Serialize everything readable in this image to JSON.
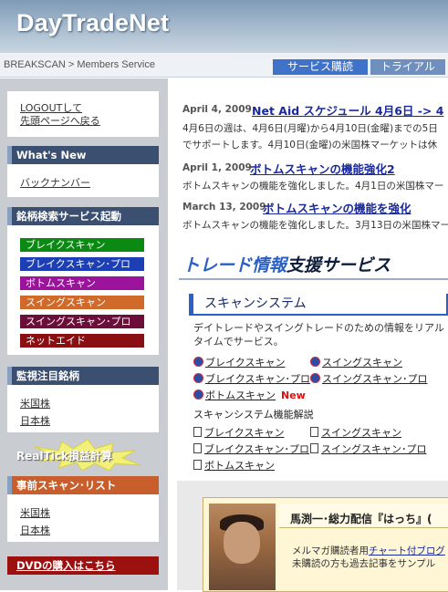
{
  "header": {
    "logo": "DayTradeNet",
    "breadcrumb": "BREAKSCAN > Members Service",
    "tabs": [
      "サービス購読",
      "トライアル"
    ]
  },
  "sidebar": {
    "logout": [
      "LOGOUTして",
      "先頭ページへ戻る"
    ],
    "whats_new": "What's New",
    "backnumber": "バックナンバー",
    "scan_launch": "銘柄検索サービス起動",
    "scan_buttons": [
      {
        "label": "ブレイクスキャン",
        "color": "#0a8a12"
      },
      {
        "label": "ブレイクスキャン･プロ",
        "color": "#1d3fb5"
      },
      {
        "label": "ボトムスキャン",
        "color": "#9b129b"
      },
      {
        "label": "スイングスキャン",
        "color": "#d06a2a"
      },
      {
        "label": "スイングスキャン･プロ",
        "color": "#6b0f3a"
      },
      {
        "label": "ネットエイド",
        "color": "#8a0f12"
      }
    ],
    "watch": "監視注目銘柄",
    "watch_links": [
      "米国株",
      "日本株"
    ],
    "badge": "RealTick損益計算",
    "prescan": "事前スキャン･リスト",
    "prescan_links": [
      "米国株",
      "日本株"
    ],
    "dvd": "DVDの購入はこちら"
  },
  "news": [
    {
      "date": "April 4, 2009",
      "title": "Net Aid スケジュール 4月6日 -> 4",
      "body": [
        "4月6日の週は、4月6日(月曜)から4月10日(金曜)までの5日",
        "でサポートします。4月10日(金曜)の米国株マーケットは休"
      ]
    },
    {
      "date": "April 1, 2009",
      "title": "ボトムスキャンの機能強化2",
      "body": [
        "ボトムスキャンの機能を強化しました。4月1日の米国株マー"
      ]
    },
    {
      "date": "March 13, 2009",
      "title": "ボトムスキャンの機能を強化",
      "body": [
        "ボトムスキャンの機能を強化しました。3月13日の米国株マー"
      ]
    }
  ],
  "trade_heading": {
    "accent": "トレード情報",
    "rest": "支援サービス"
  },
  "scan_system": {
    "title": "スキャンシステム",
    "desc": "デイトレードやスイングトレードのための情報をリアルタイムでサービス。",
    "links_left": [
      "ブレイクスキャン",
      "ブレイクスキャン･プロ",
      "ボトムスキャン"
    ],
    "links_right": [
      "スイングスキャン",
      "スイングスキャン･プロ"
    ],
    "new_label": "New",
    "manual_title": "スキャンシステム機能解説",
    "manual_left": [
      "ブレイクスキャン",
      "ブレイクスキャン･プロ",
      "ボトムスキャン"
    ],
    "manual_right": [
      "スイングスキャン",
      "スイングスキャン･プロ"
    ]
  },
  "promo": {
    "title": "馬渕一･総力配信『はっち』(",
    "text1_pre": "メルマガ購読者用",
    "text1_link": "チャート付ブログ",
    "text2": "未購読の方も過去記事をサンプル"
  }
}
